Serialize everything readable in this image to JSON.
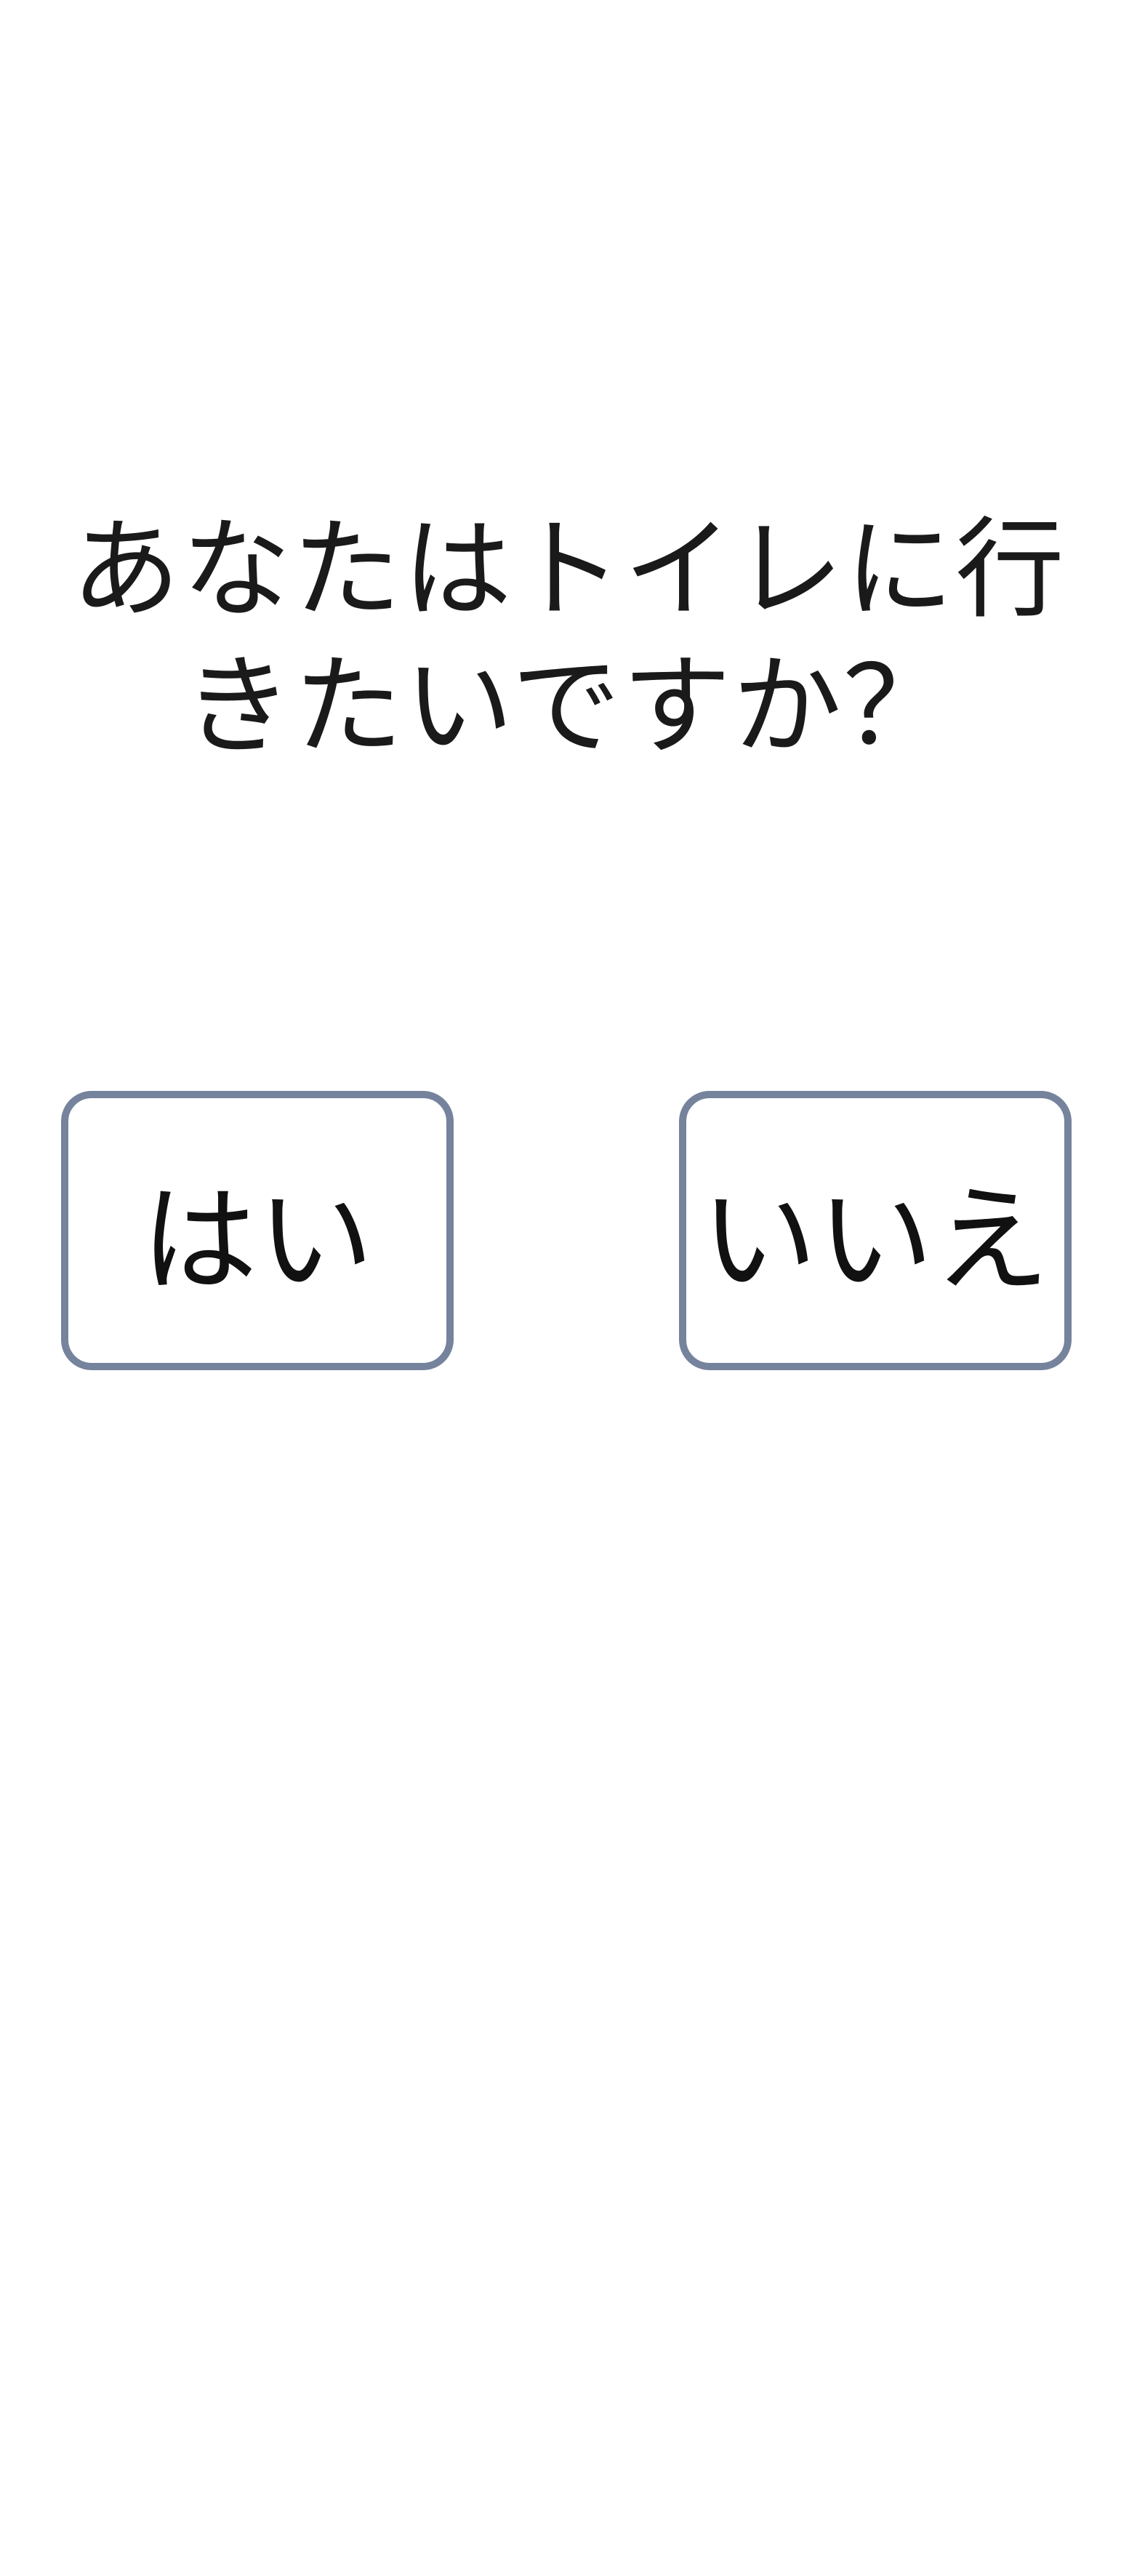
{
  "question": {
    "text": "あなたはトイレに行きたいですか？"
  },
  "answers": {
    "yes_label": "はい",
    "no_label": "いいえ"
  },
  "colors": {
    "background": "#ffffff",
    "text": "#1a1a1a",
    "button_border": "#75839c"
  }
}
